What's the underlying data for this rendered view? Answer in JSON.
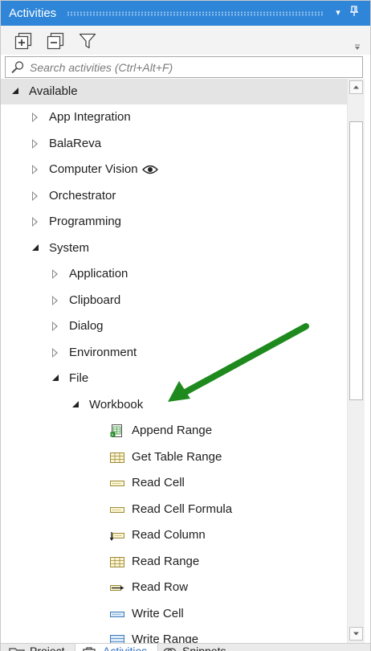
{
  "panel": {
    "title": "Activities",
    "pin_glyph": "⬇",
    "dropdown_glyph": "▾"
  },
  "toolbar": {
    "expand_all": "expand-all-icon",
    "collapse_all": "collapse-all-icon",
    "filter": "filter-icon"
  },
  "search": {
    "placeholder": "Search activities (Ctrl+Alt+F)",
    "value": ""
  },
  "tree": {
    "root": {
      "label": "Available",
      "expanded": true
    },
    "categories": [
      {
        "label": "App Integration",
        "expanded": false
      },
      {
        "label": "BalaReva",
        "expanded": false
      },
      {
        "label": "Computer Vision",
        "expanded": false,
        "badge_icon": "eye-icon"
      },
      {
        "label": "Orchestrator",
        "expanded": false
      },
      {
        "label": "Programming",
        "expanded": false
      },
      {
        "label": "System",
        "expanded": true
      }
    ],
    "system_children": [
      {
        "label": "Application",
        "expanded": false
      },
      {
        "label": "Clipboard",
        "expanded": false
      },
      {
        "label": "Dialog",
        "expanded": false
      },
      {
        "label": "Environment",
        "expanded": false
      },
      {
        "label": "File",
        "expanded": true
      }
    ],
    "file_children": [
      {
        "label": "Workbook",
        "expanded": true
      }
    ],
    "workbook_activities": [
      {
        "label": "Append Range",
        "icon": "excel-append-icon"
      },
      {
        "label": "Get Table Range",
        "icon": "table-range-icon"
      },
      {
        "label": "Read Cell",
        "icon": "read-cell-icon"
      },
      {
        "label": "Read Cell Formula",
        "icon": "read-cell-formula-icon"
      },
      {
        "label": "Read Column",
        "icon": "read-column-icon"
      },
      {
        "label": "Read Range",
        "icon": "read-range-icon"
      },
      {
        "label": "Read Row",
        "icon": "read-row-icon"
      },
      {
        "label": "Write Cell",
        "icon": "write-cell-icon"
      },
      {
        "label": "Write Range",
        "icon": "write-range-icon"
      }
    ]
  },
  "bottom_tabs": [
    {
      "label": "Project",
      "icon": "folder-icon",
      "active": false
    },
    {
      "label": "Activities",
      "icon": "activities-icon",
      "active": true
    },
    {
      "label": "Snippets",
      "icon": "snippets-icon",
      "active": false
    }
  ],
  "colors": {
    "title_bar": "#2f86d8",
    "selected_row": "#e4e4e4",
    "annotation_arrow": "#1e8a1e",
    "active_tab_text": "#2f6fc7"
  }
}
